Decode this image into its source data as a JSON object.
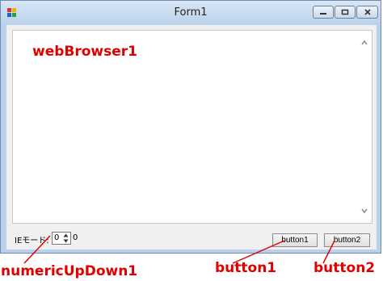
{
  "window": {
    "title": "Form1",
    "controls": {
      "minimize_icon": "minimize-icon",
      "maximize_icon": "maximize-icon",
      "close_icon": "close-icon"
    }
  },
  "form": {
    "ie_mode_label": "IEモード:",
    "numeric_up_down_value": "0",
    "after_label": "0",
    "button1_label": "button1",
    "button2_label": "button2"
  },
  "annotations": {
    "web_browser": "webBrowser1",
    "numeric_up_down": "numericUpDown1",
    "button1": "button1",
    "button2": "button2",
    "color": "#e00000"
  }
}
